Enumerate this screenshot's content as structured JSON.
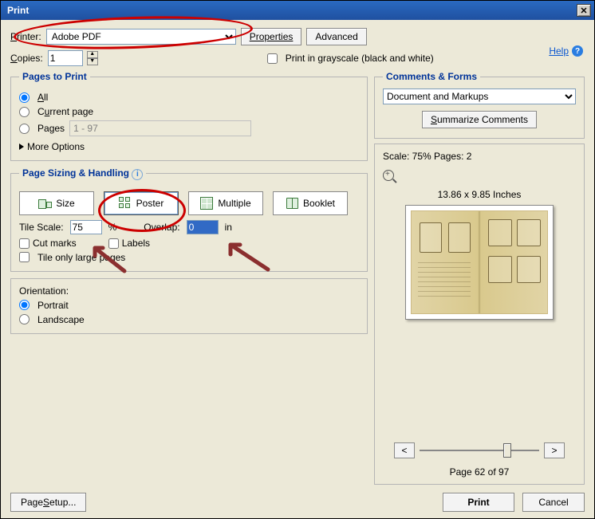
{
  "window": {
    "title": "Print"
  },
  "help": {
    "label": "Help"
  },
  "printer": {
    "label": "Printer:",
    "label_ul": "P",
    "selected": "Adobe PDF",
    "properties": "Properties",
    "advanced": "Advanced"
  },
  "copies": {
    "label": "Copies:",
    "label_ul": "C",
    "value": "1"
  },
  "grayscale": {
    "label": "Print in grayscale (black and white)",
    "checked": false
  },
  "pagesToPrint": {
    "legend": "Pages to Print",
    "all": {
      "label": "All",
      "ul": "A"
    },
    "current": {
      "label": "Current page",
      "ul": "u"
    },
    "pages": {
      "label": "Pages",
      "ul": "g",
      "value": "1 - 97"
    },
    "selected": "all",
    "more": "More Options"
  },
  "sizing": {
    "legend": "Page Sizing & Handling",
    "size": "Size",
    "poster": "Poster",
    "multiple": "Multiple",
    "booklet": "Booklet",
    "tileScaleLabel": "Tile Scale:",
    "tileScaleValue": "75",
    "percent": "%",
    "overlapLabel": "Overlap:",
    "overlapValue": "0",
    "overlapUnit": "in",
    "cutmarks": "Cut marks",
    "labels": "Labels",
    "tileOnly": "Tile only large pages"
  },
  "orientation": {
    "legend": "Orientation:",
    "portrait": "Portrait",
    "landscape": "Landscape",
    "selected": "portrait"
  },
  "commentsForms": {
    "legend": "Comments & Forms",
    "selected": "Document and Markups",
    "summarize": "Summarize Comments"
  },
  "preview": {
    "status": "Scale:  75% Pages: 2",
    "dimensions": "13.86 x 9.85 Inches",
    "pageInfo": "Page 62 of 97",
    "prev": "<",
    "next": ">"
  },
  "bottom": {
    "pageSetup": "Page Setup...",
    "print": "Print",
    "cancel": "Cancel"
  }
}
